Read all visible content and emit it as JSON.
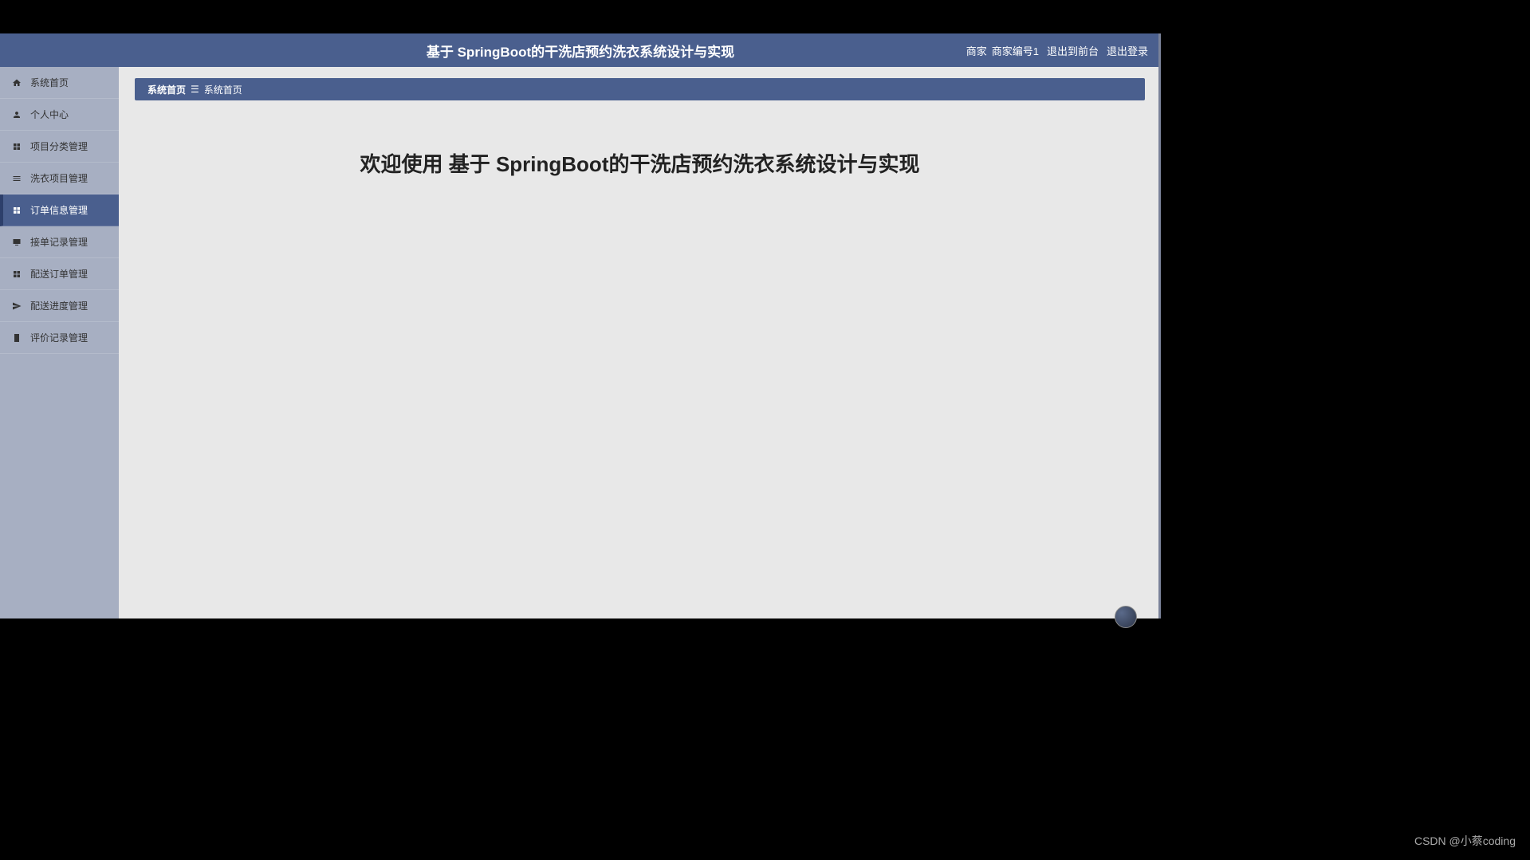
{
  "header": {
    "title": "基于 SpringBoot的干洗店预约洗衣系统设计与实现",
    "role": "商家",
    "user": "商家编号1",
    "exit_front": "退出到前台",
    "logout": "退出登录"
  },
  "sidebar": {
    "items": [
      {
        "label": "系统首页",
        "icon": "home"
      },
      {
        "label": "个人中心",
        "icon": "user"
      },
      {
        "label": "项目分类管理",
        "icon": "grid"
      },
      {
        "label": "洗衣项目管理",
        "icon": "list"
      },
      {
        "label": "订单信息管理",
        "icon": "grid",
        "active": true
      },
      {
        "label": "接单记录管理",
        "icon": "monitor"
      },
      {
        "label": "配送订单管理",
        "icon": "grid"
      },
      {
        "label": "配送进度管理",
        "icon": "send"
      },
      {
        "label": "评价记录管理",
        "icon": "clipboard"
      }
    ]
  },
  "breadcrumb": {
    "main": "系统首页",
    "sep": "☰",
    "current": "系统首页"
  },
  "main": {
    "welcome": "欢迎使用 基于 SpringBoot的干洗店预约洗衣系统设计与实现"
  },
  "watermark": "CSDN @小蔡coding"
}
